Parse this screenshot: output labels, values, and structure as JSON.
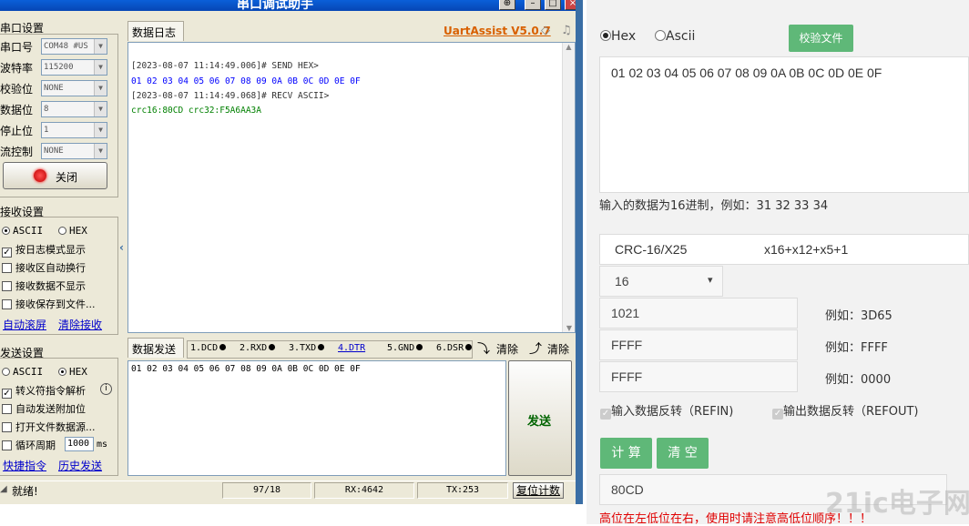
{
  "uart": {
    "title": "串口调试助手",
    "brand": "UartAssist V5.0.7",
    "serial_settings": {
      "title": "串口设置",
      "rows": [
        {
          "label": "串口号",
          "value": "COM48 #US"
        },
        {
          "label": "波特率",
          "value": "115200"
        },
        {
          "label": "校验位",
          "value": "NONE"
        },
        {
          "label": "数据位",
          "value": "8"
        },
        {
          "label": "停止位",
          "value": "1"
        },
        {
          "label": "流控制",
          "value": "NONE"
        }
      ],
      "close_button": "关闭"
    },
    "receive_settings": {
      "title": "接收设置",
      "ascii": "ASCII",
      "hex": "HEX",
      "options": [
        "按日志模式显示",
        "接收区自动换行",
        "接收数据不显示",
        "接收保存到文件..."
      ],
      "links": [
        "自动滚屏",
        "清除接收"
      ]
    },
    "send_settings": {
      "title": "发送设置",
      "ascii": "ASCII",
      "hex": "HEX",
      "options": [
        "转义符指令解析",
        "自动发送附加位",
        "打开文件数据源...",
        "循环周期"
      ],
      "cycle_value": "1000",
      "cycle_unit": "ms",
      "links": [
        "快捷指令",
        "历史发送"
      ]
    },
    "log": {
      "tab": "数据日志",
      "lines": [
        "[2023-08-07 11:14:49.006]# SEND HEX>",
        "01 02 03 04 05 06 07 08 09 0A 0B 0C 0D 0E 0F",
        "[2023-08-07 11:14:49.068]# RECV ASCII>",
        "crc16:80CD   crc32:F5A6AA3A"
      ]
    },
    "send": {
      "tab": "数据发送",
      "pins": [
        "1.DCD",
        "2.RXD",
        "3.TXD",
        "4.DTR",
        "5.GND",
        "6.DSR"
      ],
      "clear1": "清除",
      "clear2": "清除",
      "input": "01 02 03 04 05 06 07 08 09 0A 0B 0C 0D 0E 0F",
      "send_button": "发送"
    },
    "status": {
      "ready": "就绪!",
      "count": "97/18",
      "rx": "RX:4642",
      "tx": "TX:253",
      "reset": "复位计数"
    },
    "colors": {
      "send_hex": "#0000ff",
      "recv": "#008000",
      "brand": "#d86000"
    }
  },
  "crc_tool": {
    "hex_label": "Hex",
    "ascii_label": "Ascii",
    "verify_button": "校验文件",
    "input_value": "01 02 03 04 05 06 07 08 09 0A 0B 0C 0D 0E 0F",
    "hint": "输入的数据为16进制，例如：31 32 33 34",
    "algorithm": "CRC-16/X25",
    "poly_formula": "x16+x12+x5+1",
    "width": "16",
    "poly": "1021",
    "poly_example": "例如：3D65",
    "init": "FFFF",
    "init_example": "例如：FFFF",
    "xorout": "FFFF",
    "xorout_example": "例如：0000",
    "refin": "输入数据反转（REFIN)",
    "refout": "输出数据反转（REFOUT)",
    "calc_button": "计 算",
    "clear_button": "清 空",
    "result": "80CD",
    "warning": "高位在左低位在右，使用时请注意高低位顺序！！！",
    "watermark": "21ic电子网",
    "colors": {
      "green": "#5fb878",
      "warning": "#e00000"
    }
  }
}
